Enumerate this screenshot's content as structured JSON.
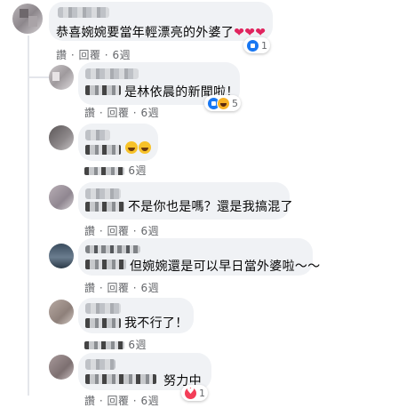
{
  "comments": [
    {
      "text": "恭喜婉婉要當年輕漂亮的外婆了",
      "emoji": "❤❤❤",
      "actions": {
        "like": "讚",
        "reply": "回覆",
        "time": "6週"
      },
      "reaction_count": "1"
    }
  ],
  "replies": [
    {
      "text": "是林依晨的新聞啦！",
      "actions": {
        "like": "讚",
        "reply": "回覆",
        "time": "6週"
      },
      "reaction_count": "5"
    },
    {
      "text": "",
      "emoji": "🤣🤣",
      "actions": {
        "time": "6週"
      }
    },
    {
      "text": "不是你也是嗎？還是我搞混了",
      "actions": {
        "like": "讚",
        "reply": "回覆",
        "time": "6週"
      }
    },
    {
      "text": "但婉婉還是可以早日當外婆啦～～",
      "actions": {
        "like": "讚",
        "reply": "回覆",
        "time": "6週"
      }
    },
    {
      "text": "我不行了！",
      "actions": {
        "time": "6週"
      }
    },
    {
      "text": "努力中",
      "actions": {
        "like": "讚",
        "reply": "回覆",
        "time": "6週"
      },
      "reaction_count": "1"
    }
  ],
  "icons": {
    "like": "like-reaction-icon",
    "love": "love-reaction-icon",
    "haha": "haha-reaction-icon"
  },
  "colors": {
    "bubble": "#f0f2f5",
    "meta_text": "#65676b",
    "like_blue": "#1877f2",
    "love_red": "#f33e58",
    "haha_yellow": "#f7b125"
  }
}
